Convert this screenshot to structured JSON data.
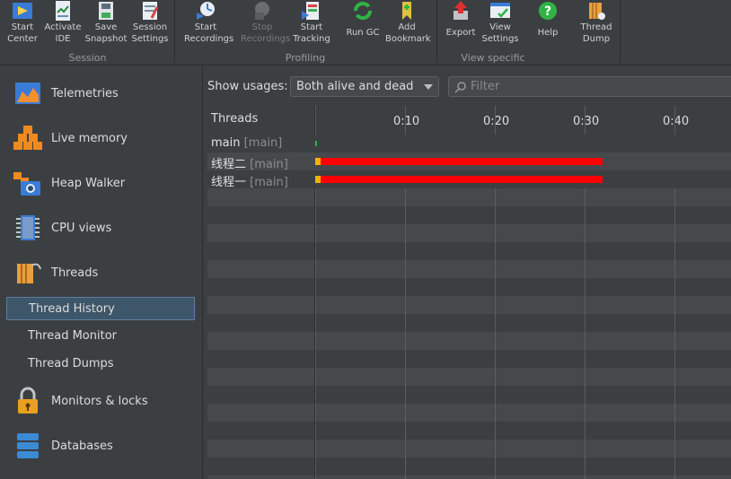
{
  "toolbar": {
    "groups": [
      {
        "label": "Session"
      },
      {
        "label": "Profiling"
      },
      {
        "label": "View specific"
      }
    ],
    "buttons": [
      {
        "line1": "Start",
        "line2": "Center",
        "icon": "start-center-icon"
      },
      {
        "line1": "Activate",
        "line2": "IDE",
        "icon": "activate-ide-icon"
      },
      {
        "line1": "Save",
        "line2": "Snapshot",
        "icon": "save-snapshot-icon"
      },
      {
        "line1": "Session",
        "line2": "Settings",
        "icon": "session-settings-icon"
      },
      {
        "line1": "Start",
        "line2": "Recordings",
        "icon": "start-recordings-icon"
      },
      {
        "line1": "Stop",
        "line2": "Recordings",
        "icon": "stop-recordings-icon"
      },
      {
        "line1": "Start",
        "line2": "Tracking",
        "icon": "start-tracking-icon"
      },
      {
        "line1": "Run GC",
        "line2": "",
        "icon": "run-gc-icon"
      },
      {
        "line1": "Add",
        "line2": "Bookmark",
        "icon": "add-bookmark-icon"
      },
      {
        "line1": "Export",
        "line2": "",
        "icon": "export-icon"
      },
      {
        "line1": "View",
        "line2": "Settings",
        "icon": "view-settings-icon"
      },
      {
        "line1": "Help",
        "line2": "",
        "icon": "help-icon"
      },
      {
        "line1": "Thread",
        "line2": "Dump",
        "icon": "thread-dump-icon"
      }
    ]
  },
  "sidebar": {
    "items": [
      {
        "label": "Telemetries"
      },
      {
        "label": "Live memory"
      },
      {
        "label": "Heap Walker"
      },
      {
        "label": "CPU views"
      },
      {
        "label": "Threads"
      },
      {
        "label": "Monitors & locks"
      },
      {
        "label": "Databases"
      }
    ],
    "subitems": [
      {
        "label": "Thread History",
        "selected": true
      },
      {
        "label": "Thread Monitor"
      },
      {
        "label": "Thread Dumps"
      }
    ]
  },
  "filters": {
    "show_label": "Show usages:",
    "dropdown_value": "Both alive and dead",
    "filter_placeholder": "Filter"
  },
  "timeline": {
    "column_header": "Threads",
    "ticks": [
      "0:10",
      "0:20",
      "0:30",
      "0:40"
    ],
    "threads": [
      {
        "name": "main",
        "group": "[main]"
      },
      {
        "name": "线程二",
        "group": "[main]"
      },
      {
        "name": "线程一",
        "group": "[main]"
      }
    ]
  },
  "colors": {
    "bar_running": "#ff0000",
    "bar_start": "#f0b400",
    "accent_selected": "#3d5669"
  }
}
